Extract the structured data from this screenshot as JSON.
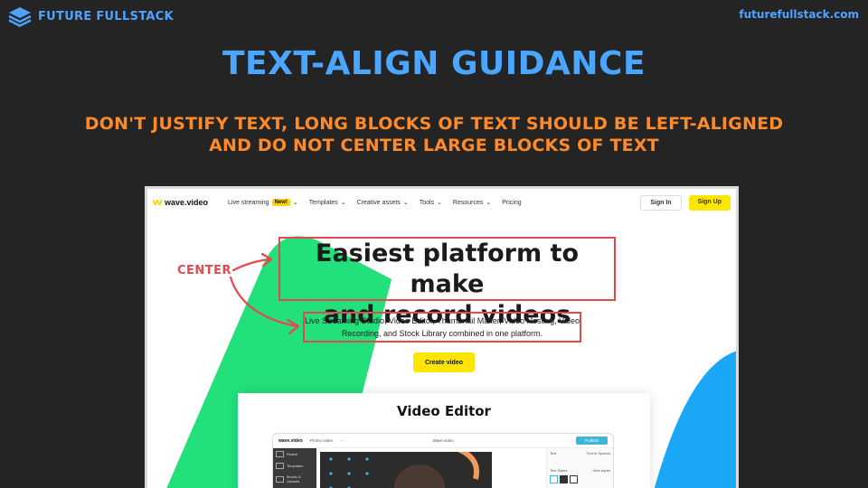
{
  "brand": {
    "name": "FUTURE FULLSTACK",
    "url": "futurefullstack.com",
    "icon": "layers-stack-icon"
  },
  "slide": {
    "title": "TEXT-ALIGN GUIDANCE",
    "subtitle_line1": "DON'T JUSTIFY TEXT, LONG BLOCKS OF TEXT SHOULD BE LEFT-ALIGNED",
    "subtitle_line2": "AND DO NOT CENTER LARGE BLOCKS OF TEXT"
  },
  "screenshot": {
    "logo": "wave.video",
    "nav": [
      {
        "label": "Live streaming",
        "badge": "New!"
      },
      {
        "label": "Templates"
      },
      {
        "label": "Creative assets"
      },
      {
        "label": "Tools"
      },
      {
        "label": "Resources"
      },
      {
        "label": "Pricing"
      }
    ],
    "sign_in": "Sign In",
    "sign_up": "Sign Up",
    "hero_line1": "Easiest platform to make",
    "hero_line2": "and record videos",
    "hero_desc_line1": "Live Streaming Studio, Video Editor, Thumbnail Maker, Video Hosting, Video",
    "hero_desc_line2": "Recording, and Stock Library combined in one platform.",
    "cta": "Create video",
    "annotation": "CENTER",
    "section_title": "Video Editor",
    "editor": {
      "logo": "wave.video",
      "project": "Promo video",
      "channel": "Wave.video",
      "publish": "Publish",
      "side_items": [
        "Resize",
        "Templates",
        "Stocks & Uploads"
      ],
      "right_tabs": [
        "Text",
        "Text to Speech"
      ],
      "right_labels": [
        "Text Styles",
        "Hide styles"
      ]
    }
  },
  "colors": {
    "background": "#242424",
    "title": "#4aa6ff",
    "subtitle": "#ff8a2a",
    "annotation": "#e5484d",
    "green_shape": "#22e07a",
    "blue_shape": "#1aa7f5",
    "cta": "#ffe600"
  }
}
